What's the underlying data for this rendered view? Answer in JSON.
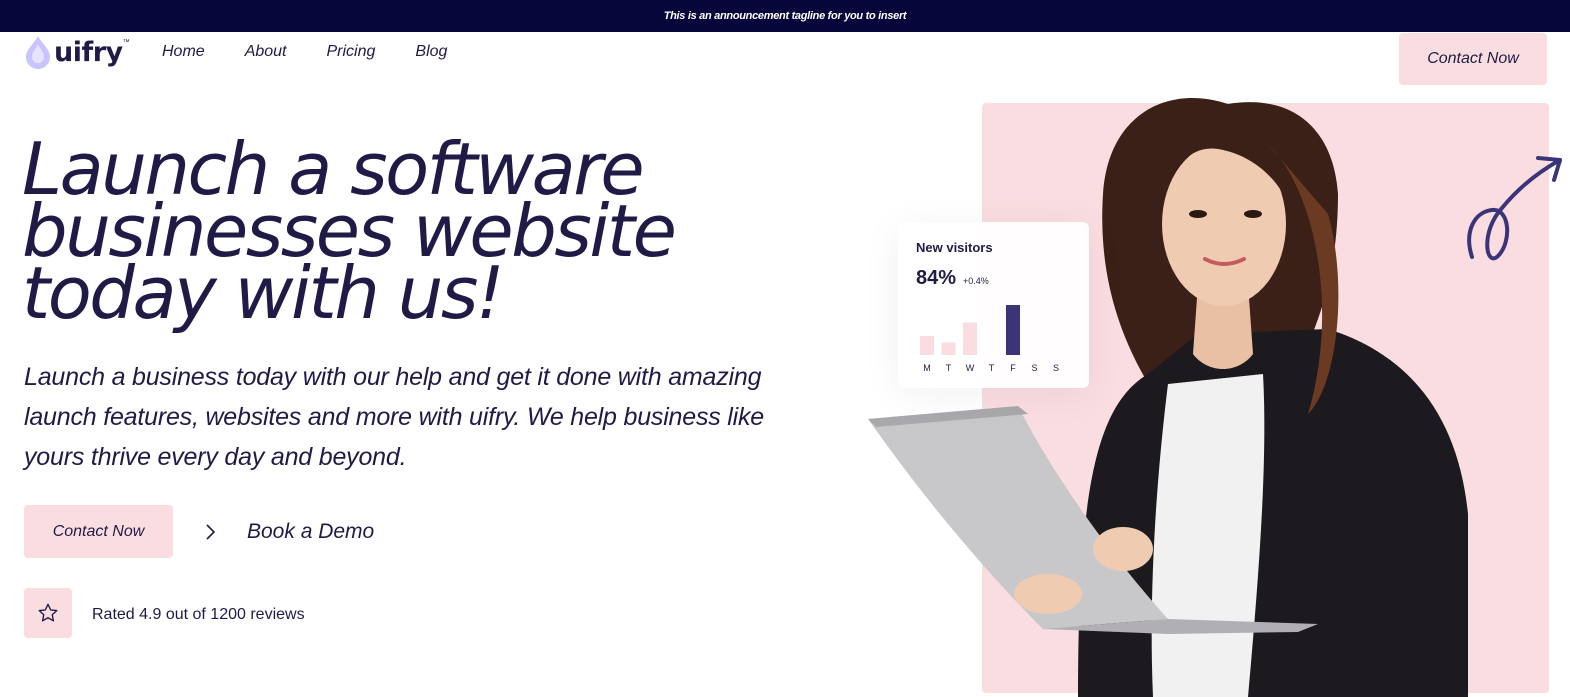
{
  "announcement": "This is an announcement tagline for you to insert",
  "logo": {
    "text": "uifry",
    "tm": "™",
    "accent": "#c9c4ff"
  },
  "nav": {
    "items": [
      "Home",
      "About",
      "Pricing",
      "Blog"
    ]
  },
  "header_cta": "Contact Now",
  "hero": {
    "headline": [
      "Launch a software",
      "businesses website",
      "today with us!"
    ],
    "subtext": "Launch a business today with our help and get it done with amazing launch features, websites and more with uifry. We help business like yours thrive every day and beyond.",
    "primary_cta": "Contact Now",
    "secondary_cta": "Book a Demo",
    "rating_text": "Rated 4.9 out of 1200 reviews"
  },
  "visitors_card": {
    "title": "New visitors",
    "value": "84%",
    "delta": "+0.4%",
    "days": [
      "M",
      "T",
      "W",
      "T",
      "F",
      "S",
      "S"
    ],
    "levels": [
      0.38,
      0.25,
      0.65,
      0,
      1,
      0,
      0
    ],
    "highlight_index": 4
  },
  "colors": {
    "navy": "#06063a",
    "ink": "#1f1b46",
    "pink": "#fadde0",
    "bar": "#3c3478",
    "bar_light": "#fadde0"
  },
  "icons": {
    "star": "star-icon",
    "chevron": "chevron-right-icon",
    "logo": "drop-logo-icon",
    "doodle": "arrow-doodle-icon"
  }
}
